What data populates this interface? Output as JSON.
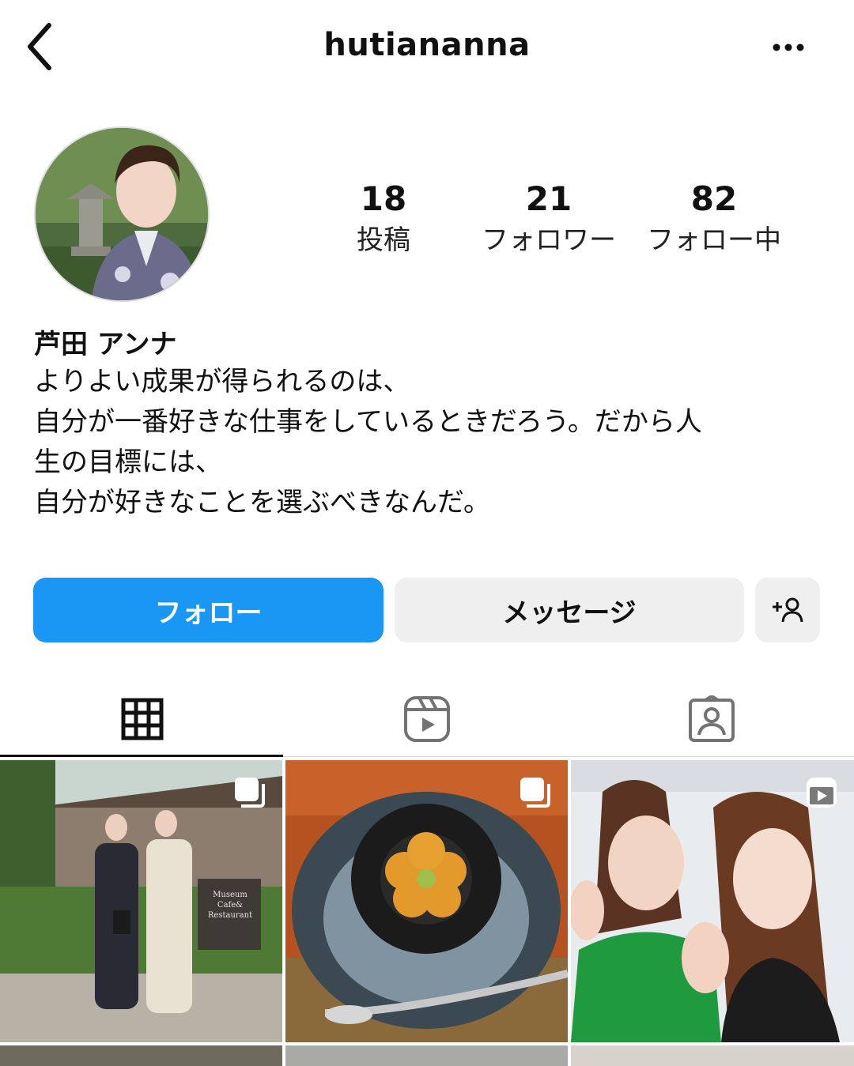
{
  "header": {
    "username": "hutiananna"
  },
  "stats": [
    {
      "value": "18",
      "label": "投稿"
    },
    {
      "value": "21",
      "label": "フォロワー"
    },
    {
      "value": "82",
      "label": "フォロー中"
    }
  ],
  "profile": {
    "display_name": "芦田 アンナ",
    "bio_lines": [
      "よりよい成果が得られるのは、",
      "自分が一番好きな仕事をしているときだろう。だから人",
      "生の目標には、",
      "自分が好きなことを選ぶべきなんだ。"
    ]
  },
  "actions": {
    "follow_label": "フォロー",
    "message_label": "メッセージ"
  },
  "tabs": [
    "grid-icon",
    "reels-icon",
    "tagged-icon"
  ],
  "grid": {
    "posts": [
      {
        "badge": "carousel-icon",
        "sign_lines": [
          "Museum",
          "Cafe&",
          "Restaurant"
        ]
      },
      {
        "badge": "carousel-icon"
      },
      {
        "badge": "reel-icon"
      }
    ]
  },
  "colors": {
    "accent": "#1a97f5",
    "secondary_button": "#efefef"
  }
}
